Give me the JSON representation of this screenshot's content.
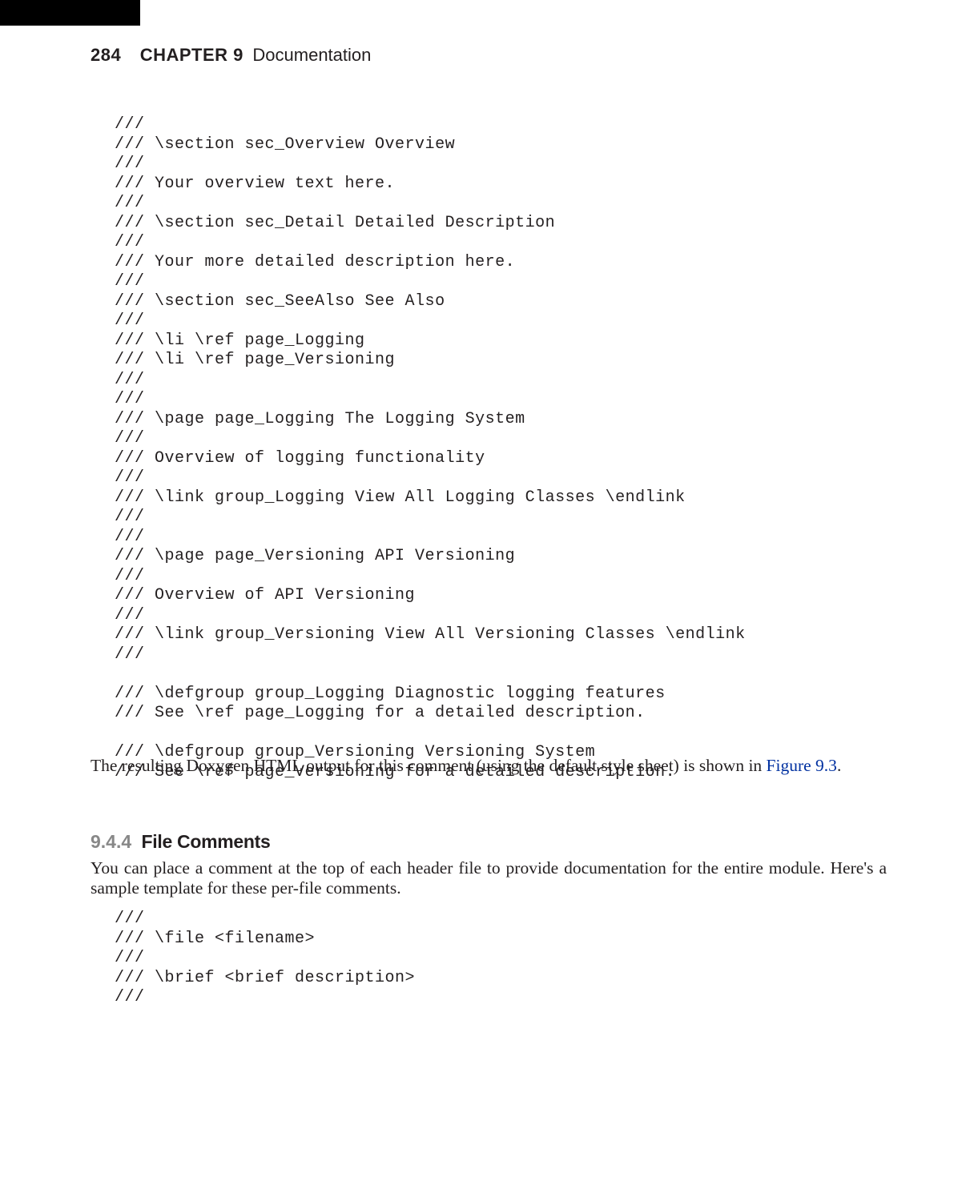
{
  "header": {
    "pageno": "284",
    "chapter_label": "CHAPTER 9",
    "chapter_title": "Documentation"
  },
  "code1": "///\n/// \\section sec_Overview Overview\n///\n/// Your overview text here.\n///\n/// \\section sec_Detail Detailed Description\n///\n/// Your more detailed description here.\n///\n/// \\section sec_SeeAlso See Also\n///\n/// \\li \\ref page_Logging\n/// \\li \\ref page_Versioning\n///\n///\n/// \\page page_Logging The Logging System\n///\n/// Overview of logging functionality\n///\n/// \\link group_Logging View All Logging Classes \\endlink\n///\n///\n/// \\page page_Versioning API Versioning\n///\n/// Overview of API Versioning\n///\n/// \\link group_Versioning View All Versioning Classes \\endlink\n///\n\n/// \\defgroup group_Logging Diagnostic logging features\n/// See \\ref page_Logging for a detailed description.\n\n/// \\defgroup group_Versioning Versioning System\n/// See \\ref page_Versioning for a detailed description.",
  "para1_pre": "The resulting Doxygen HTML output for this comment (using the default style sheet) is shown in ",
  "para1_ref": "Figure 9.3",
  "para1_post": ".",
  "section": {
    "number": "9.4.4",
    "title": "File Comments"
  },
  "para2": "You can place a comment at the top of each header file to provide documentation for the entire module. Here's a sample template for these per-file comments.",
  "code2": "///\n/// \\file <filename>\n///\n/// \\brief <brief description>\n///"
}
